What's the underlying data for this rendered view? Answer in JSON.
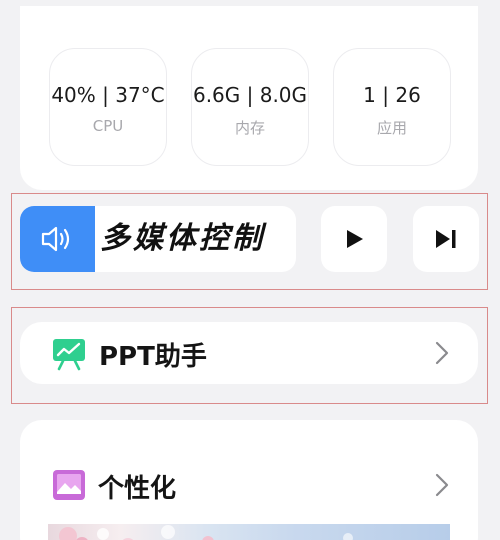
{
  "stats": [
    {
      "value": "40% | 37°C",
      "label": "CPU"
    },
    {
      "value": "6.6G | 8.0G",
      "label": "内存"
    },
    {
      "value": "1 | 26",
      "label": "应用"
    }
  ],
  "media": {
    "title": "多媒体控制",
    "speaker_icon": "speaker-icon",
    "play_icon": "play-icon",
    "next_icon": "skip-next-icon"
  },
  "ppt": {
    "title": "PPT助手",
    "icon": "presentation-icon"
  },
  "personalize": {
    "title": "个性化",
    "icon": "image-icon"
  },
  "colors": {
    "accent": "#3f8ef7",
    "ppt_green": "#2fcf8f",
    "personalize_purple": "#c86ad8"
  }
}
